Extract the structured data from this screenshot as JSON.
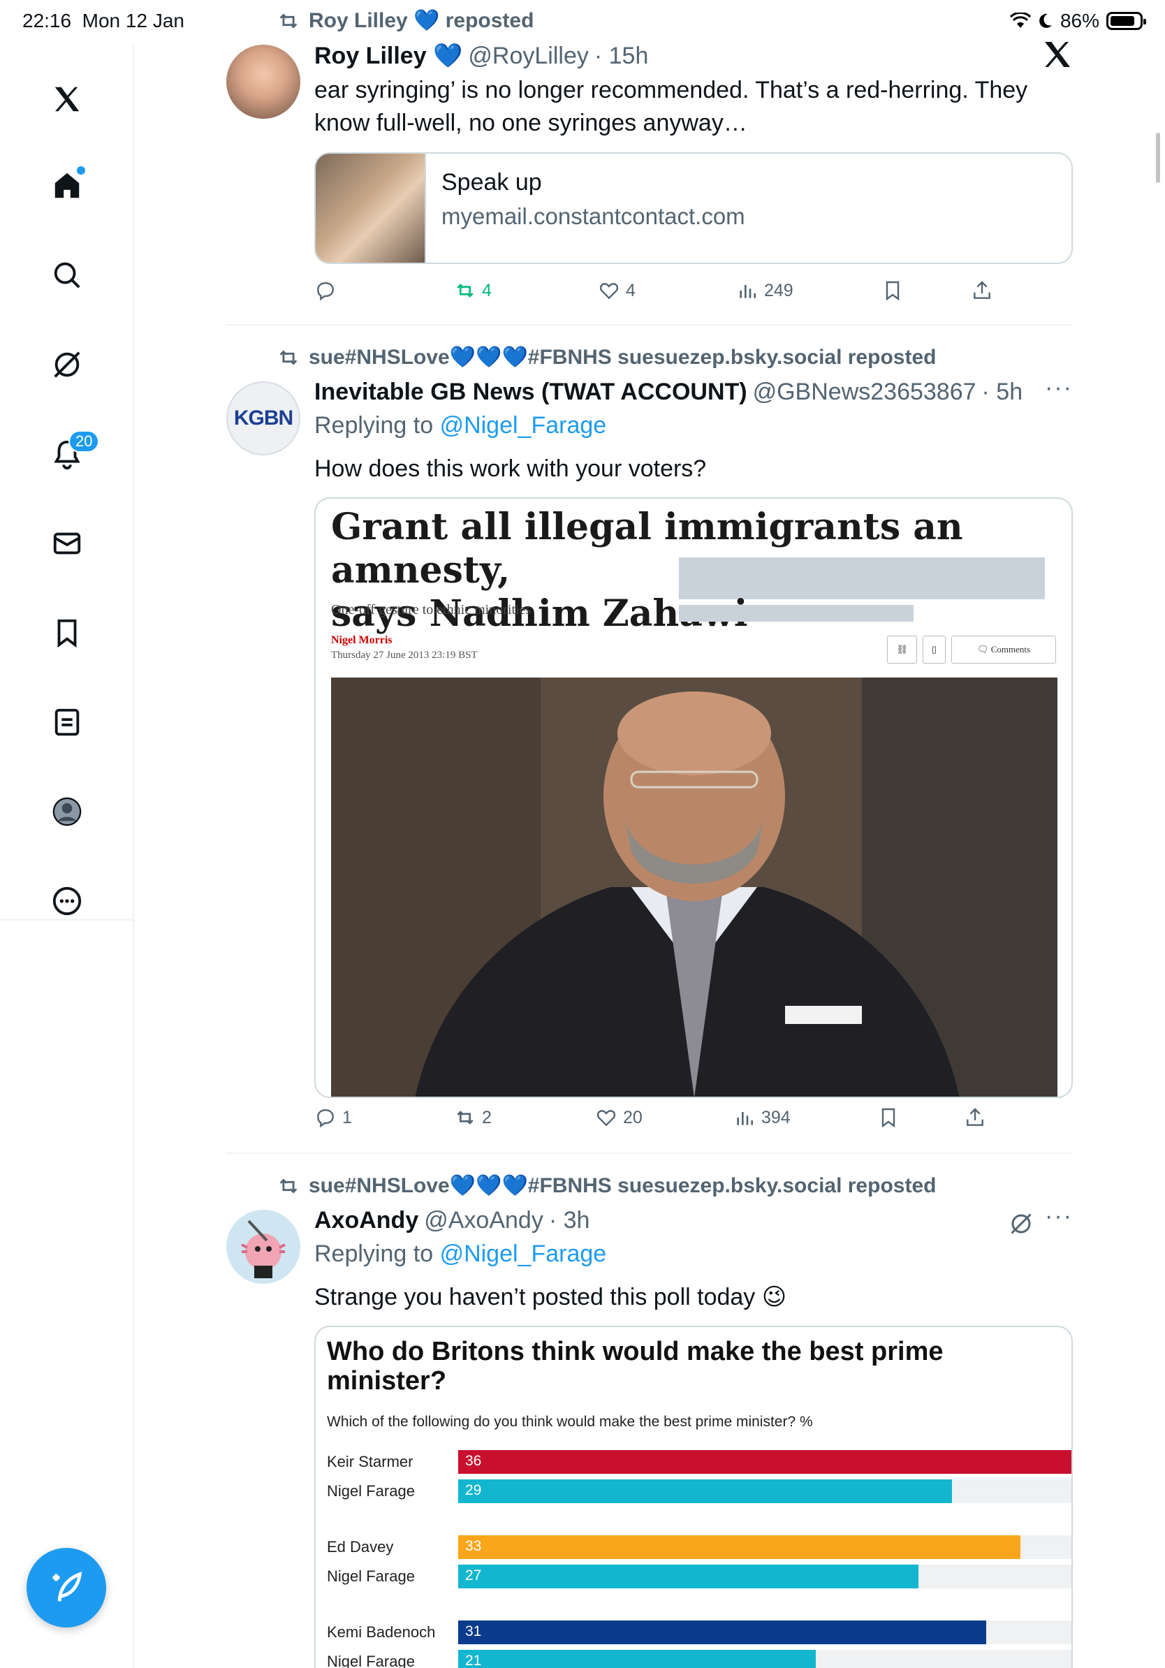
{
  "status_bar": {
    "time": "22:16",
    "date": "Mon 12 Jan",
    "battery": "86%",
    "battery_level": 0.86
  },
  "sidebar": {
    "items": [
      {
        "name": "home",
        "icon": "home-icon"
      },
      {
        "name": "explore",
        "icon": "search-icon"
      },
      {
        "name": "grok",
        "icon": "grok-icon"
      },
      {
        "name": "notifications",
        "icon": "bell-icon",
        "badge": "20"
      },
      {
        "name": "messages",
        "icon": "mail-icon"
      },
      {
        "name": "bookmarks",
        "icon": "bookmark-icon"
      },
      {
        "name": "lists",
        "icon": "list-icon"
      },
      {
        "name": "profile",
        "icon": "avatar-icon"
      },
      {
        "name": "more",
        "icon": "more-icon"
      }
    ],
    "compose_icon": "compose-icon"
  },
  "tweets": [
    {
      "social_context": "Roy Lilley 💙 reposted",
      "display_name": "Roy Lilley 💙",
      "handle": "@RoyLilley",
      "time": "· 15h",
      "text": "ear syringing’ is no longer recommended. That’s a red-herring. They know full-well, no one syringes anyway…",
      "link_card": {
        "title": "Speak up",
        "domain": "myemail.constantcontact.com"
      },
      "stats": {
        "replies": "",
        "reposts": "4",
        "likes": "4",
        "views": "249"
      }
    },
    {
      "social_context": "sue#NHSLove💙💙💙#FBNHS suesuezep.bsky.social reposted",
      "display_name": "Inevitable GB News (TWAT ACCOUNT)",
      "handle": "@GBNews23653867",
      "time": "· 5h",
      "reply_prefix": "Replying to",
      "reply_to": "@Nigel_Farage",
      "text": "How does this work with your voters?",
      "avatar_text": "KGBN",
      "article": {
        "headline_1": "Grant all illegal immigrants an amnesty,",
        "headline_2": "says Nadhim Zahawi",
        "standfirst": "One-off gesture to ethnic minorities",
        "author": "Nigel Morris",
        "date": "Thursday 27 June 2013 23:19 BST",
        "comments_label": "Comments"
      },
      "stats": {
        "replies": "1",
        "reposts": "2",
        "likes": "20",
        "views": "394"
      }
    },
    {
      "social_context": "sue#NHSLove💙💙💙#FBNHS suesuezep.bsky.social reposted",
      "display_name": "AxoAndy",
      "handle": "@AxoAndy",
      "time": "· 3h",
      "reply_prefix": "Replying to",
      "reply_to": "@Nigel_Farage",
      "text": "Strange you haven’t posted this poll today 😉",
      "poll_chart": {
        "title": "Who do Britons think would make the best prime minister?",
        "subtitle": "Which of the following do you think would make the best prime minister? %"
      }
    }
  ],
  "chart_data": {
    "type": "bar",
    "title": "Who do Britons think would make the best prime minister?",
    "subtitle": "Which of the following do you think would make the best prime minister? %",
    "xlim": [
      0,
      36
    ],
    "groups": [
      {
        "rows": [
          {
            "label": "Keir Starmer",
            "value": 36,
            "color": "#c8102e"
          },
          {
            "label": "Nigel Farage",
            "value": 29,
            "color": "#12b6cf"
          }
        ]
      },
      {
        "rows": [
          {
            "label": "Ed Davey",
            "value": 33,
            "color": "#faa61a"
          },
          {
            "label": "Nigel Farage",
            "value": 27,
            "color": "#12b6cf"
          }
        ]
      },
      {
        "rows": [
          {
            "label": "Kemi Badenoch",
            "value": 31,
            "color": "#0a3b8c"
          },
          {
            "label": "Nigel Farage",
            "value": 21,
            "color": "#12b6cf"
          }
        ]
      }
    ]
  },
  "colors": {
    "accent": "#1d9bf0",
    "repost_green": "#00ba7c",
    "text_secondary": "#536471"
  }
}
